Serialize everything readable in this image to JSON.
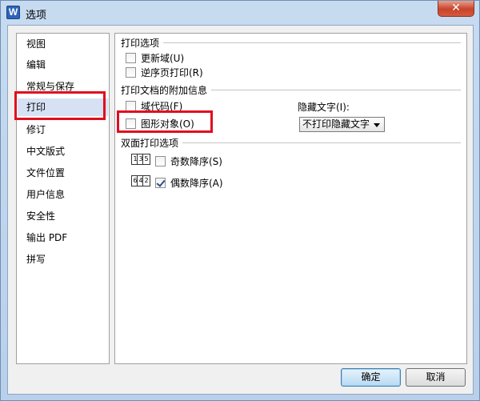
{
  "window": {
    "title": "选项",
    "app_icon_letter": "W",
    "close_glyph": "✕"
  },
  "nav": {
    "items": [
      {
        "label": "视图"
      },
      {
        "label": "编辑"
      },
      {
        "label": "常规与保存"
      },
      {
        "label": "打印"
      },
      {
        "label": "修订"
      },
      {
        "label": "中文版式"
      },
      {
        "label": "文件位置"
      },
      {
        "label": "用户信息"
      },
      {
        "label": "安全性"
      },
      {
        "label": "输出 PDF"
      },
      {
        "label": "拼写"
      }
    ],
    "selected_index": 3
  },
  "print_options": {
    "title": "打印选项",
    "update_fields": {
      "label": "更新域(U)",
      "checked": false
    },
    "reverse_order": {
      "label": "逆序页打印(R)",
      "checked": false
    }
  },
  "extra_info": {
    "title": "打印文档的附加信息",
    "field_codes": {
      "label": "域代码(F)",
      "checked": false
    },
    "drawing_objects": {
      "label": "图形对象(O)",
      "checked": false
    },
    "hidden_text_label": "隐藏文字(I):",
    "hidden_text_value": "不打印隐藏文字"
  },
  "duplex": {
    "title": "双面打印选项",
    "odd_desc": {
      "label": "奇数降序(S)",
      "checked": false,
      "pages": [
        "1",
        "3",
        "5"
      ]
    },
    "even_desc": {
      "label": "偶数降序(A)",
      "checked": true,
      "pages": [
        "6",
        "4",
        "2"
      ]
    }
  },
  "buttons": {
    "ok": "确定",
    "cancel": "取消"
  },
  "colors": {
    "highlight_red": "#e00d1f",
    "selected_bg": "#d6e2f4"
  }
}
